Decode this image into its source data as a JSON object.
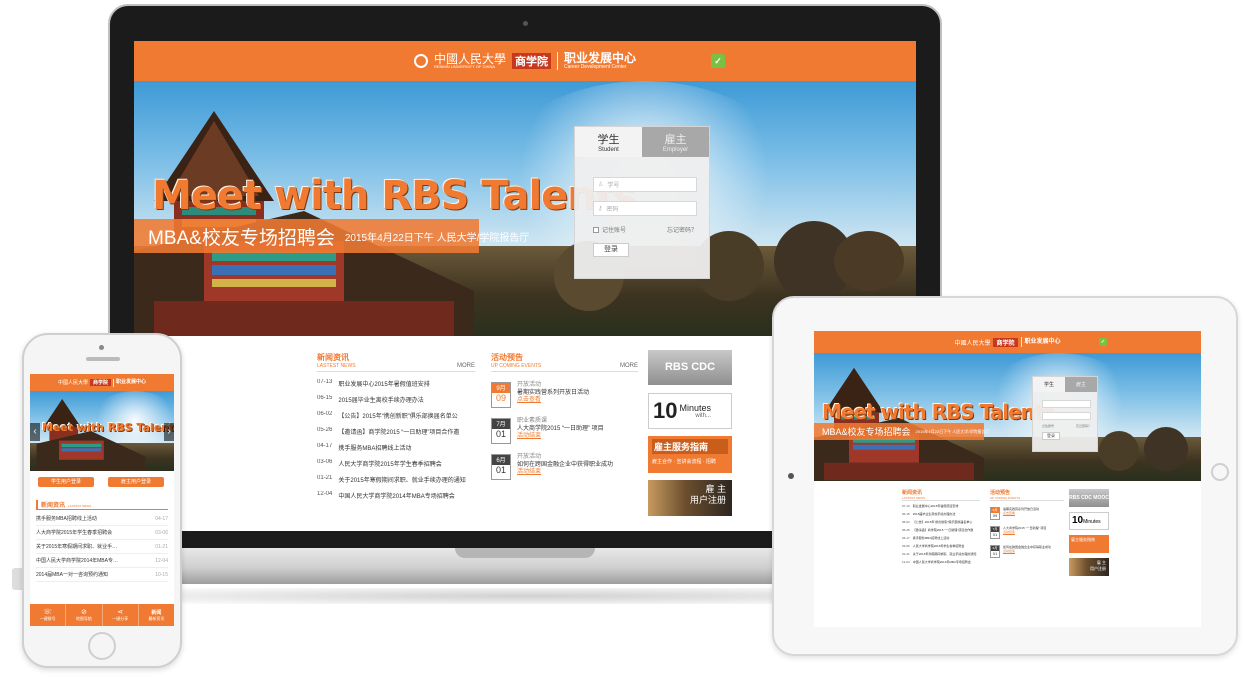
{
  "colors": {
    "brand_orange": "#f07a32",
    "rbs_red": "#c8381f",
    "wechat_green": "#7ac143",
    "dark_frame": "#1b1b1b"
  },
  "header": {
    "university": "中國人民大學",
    "university_en": "RENMIN UNIVERSITY OF CHINA",
    "rbs": "商学院",
    "cdc_cn": "职业发展中心",
    "cdc_en": "Career Development Center",
    "wechat_icon": "wechat-icon"
  },
  "hero": {
    "title": "Meet with  RBS  Talents",
    "event_name": "MBA&校友专场招聘会",
    "event_detail": "2015年4月22日下午   人民大学/学院报告厅"
  },
  "login": {
    "tab_student_cn": "学生",
    "tab_student_en": "Student",
    "tab_employer_cn": "雇主",
    "tab_employer_en": "Employer",
    "username_placeholder": "学号",
    "password_placeholder": "密码",
    "remember": "记住账号",
    "forgot": "忘记密码？",
    "submit": "登录"
  },
  "news": {
    "title": "新闻资讯",
    "subtitle": "LASTEST NEWS",
    "more": "MORE",
    "items": [
      {
        "date": "07-13",
        "text": "职业发展中心2015年暑假值班安排"
      },
      {
        "date": "06-15",
        "text": "2015届毕业生离校手续办理办法"
      },
      {
        "date": "06-02",
        "text": "【公告】2015年“携创新职”俱乐部换届名单公"
      },
      {
        "date": "05-26",
        "text": "【邀请函】商学院2015 “一日助理”项目合作邀"
      },
      {
        "date": "04-17",
        "text": "携手服务MBA招聘线上活动"
      },
      {
        "date": "03-06",
        "text": "人民大学商学院2015年学生春季招聘会"
      },
      {
        "date": "01-21",
        "text": "关于2015年寒假期间求职、就业手续办理的通知"
      },
      {
        "date": "12-04",
        "text": "中国人民大学商学院2014年MBA专场招聘会"
      }
    ]
  },
  "events": {
    "title": "活动预告",
    "subtitle": "UP COMING EVENTS",
    "more": "MORE",
    "items": [
      {
        "month": "9月",
        "day": "09",
        "tag": "开放活动",
        "text": "暑期实践营系列开放日活动",
        "link": "点击查看"
      },
      {
        "month": "7月",
        "day": "01",
        "tag": "职业素质课",
        "text": "人大商学院2015 “一日助理” 项目",
        "link": "活动结束"
      },
      {
        "month": "6月",
        "day": "01",
        "tag": "开放活动",
        "text": "如何在跨国金融企业中获得职业成功",
        "link": "活动结束"
      }
    ]
  },
  "side": {
    "mooc": "RBS CDC MOOC",
    "minutes_num": "10",
    "minutes_word": "Minutes",
    "minutes_with": "with...",
    "employer_guide": "雇主服务指南",
    "employer_guide_sub": "雇主合作 · 宣讲会流程 · 招聘",
    "employer_reg_1": "雇 主",
    "employer_reg_2": "用户注册"
  },
  "mobile": {
    "btn_student": "学生用户登录",
    "btn_employer": "雇主用户登录",
    "news_title": "新闻资讯",
    "news_sub": "LASTEST NEWS",
    "news_items": [
      {
        "text": "携手服务MBA招聘线上活动",
        "date": "04-17"
      },
      {
        "text": "人大商学院2015年学生春季招聘会",
        "date": "03-06"
      },
      {
        "text": "关于2015年寒假期间求职、就业手…",
        "date": "01-21"
      },
      {
        "text": "中国人民大学商学院2014年MBA专…",
        "date": "12-04"
      },
      {
        "text": "2014届MBA一对一咨询预约通知",
        "date": "10-15"
      }
    ],
    "nav": [
      {
        "icon": "phone-icon",
        "glyph": "☏",
        "label": "一键拨号"
      },
      {
        "icon": "compass-icon",
        "glyph": "⊘",
        "label": "地图导航"
      },
      {
        "icon": "share-icon",
        "glyph": "⋖",
        "label": "一键分享"
      },
      {
        "icon": "news-icon",
        "glyph": "新闻",
        "label": "最新资讯"
      }
    ]
  }
}
